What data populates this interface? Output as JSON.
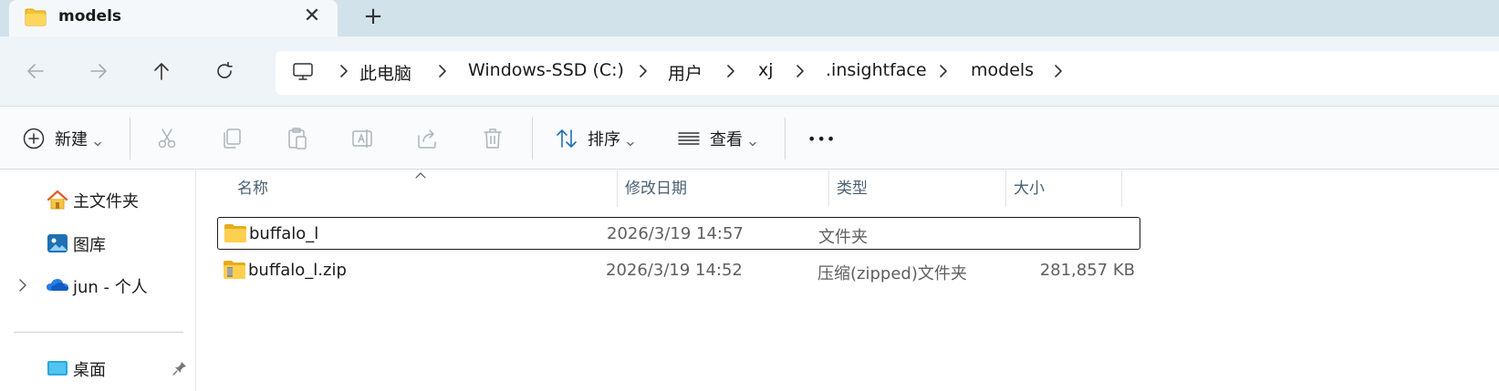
{
  "window": {
    "tab_title": "models",
    "tab_close_glyph": "✕",
    "new_tab_glyph": "+"
  },
  "nav": {
    "back_icon": "arrow-left-icon",
    "forward_icon": "arrow-right-icon",
    "up_icon": "arrow-up-icon",
    "refresh_icon": "refresh-icon"
  },
  "breadcrumb": [
    "此电脑",
    "Windows-SSD (C:)",
    "用户",
    "xj",
    ".insightface",
    "models"
  ],
  "toolbar": {
    "new_label": "新建",
    "sort_label": "排序",
    "view_label": "查看",
    "more_label": "•••"
  },
  "sidebar": {
    "items": [
      {
        "label": "主文件夹",
        "icon": "home-icon"
      },
      {
        "label": "图库",
        "icon": "gallery-icon"
      },
      {
        "label": "jun - 个人",
        "icon": "onedrive-cloud-icon"
      },
      {
        "label": "桌面",
        "icon": "desktop-icon"
      }
    ]
  },
  "columns": {
    "name": "名称",
    "modified": "修改日期",
    "type": "类型",
    "size": "大小"
  },
  "files": [
    {
      "name": "buffalo_l",
      "modified": "2026/3/19 14:57",
      "type": "文件夹",
      "size": "",
      "icon": "folder-icon",
      "selected": true
    },
    {
      "name": "buffalo_l.zip",
      "modified": "2026/3/19 14:52",
      "type": "压缩(zipped)文件夹",
      "size": "281,857 KB",
      "icon": "zip-folder-icon",
      "selected": false
    }
  ],
  "colors": {
    "tabstrip_bg": "#d2e2ea",
    "navbar_bg": "#eef4f7",
    "folder_yellow": "#f4c431",
    "accent_blue": "#1f6fb5"
  }
}
